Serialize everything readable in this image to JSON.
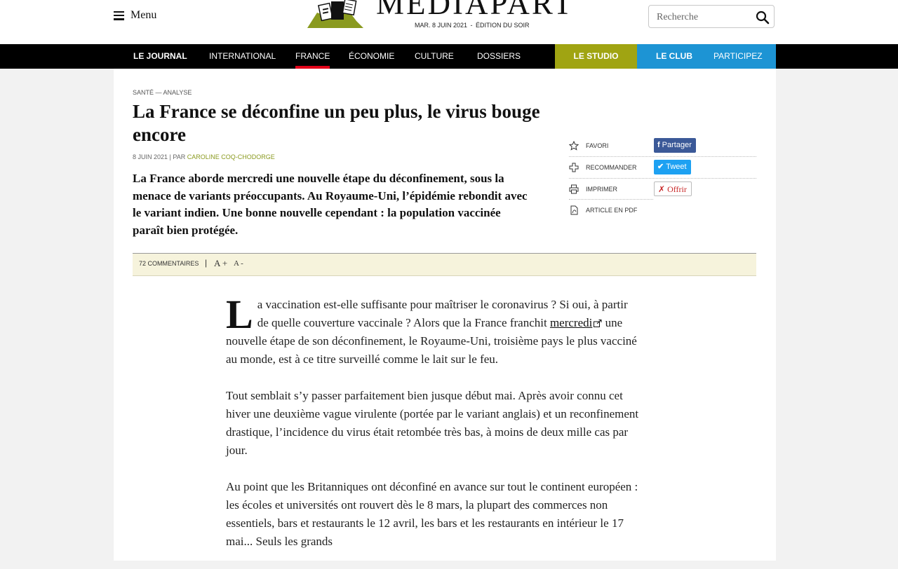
{
  "header": {
    "menu_label": "Menu",
    "logo_text": "MEDIAPART",
    "edition_date": "MAR. 8 JUIN 2021",
    "edition_label": "ÉDITION DU SOIR",
    "search_placeholder": "Recherche"
  },
  "nav": {
    "items": [
      {
        "label": "LE JOURNAL"
      },
      {
        "label": "INTERNATIONAL"
      },
      {
        "label": "FRANCE"
      },
      {
        "label": "ÉCONOMIE"
      },
      {
        "label": "CULTURE"
      },
      {
        "label": "DOSSIERS"
      }
    ],
    "active": "FRANCE",
    "studio_label": "LE STUDIO",
    "club_label": "LE CLUB",
    "participate_label": "PARTICIPEZ"
  },
  "article": {
    "kicker": "SANTÉ — ANALYSE",
    "title": "La France se déconfine un peu plus, le virus bouge encore",
    "date": "8 JUIN 2021",
    "by": "PAR",
    "author": "CAROLINE COQ-CHODORGE",
    "lede": "La France aborde mercredi une nouvelle étape du déconfinement, sous la menace de variants préoccupants. Au Royaume-Uni, l’épidémie rebondit avec le variant indien. Une bonne nouvelle cependant : la population vaccinée paraît bien protégée.",
    "dropcap": "L",
    "p1_text_a": "a vaccination est-elle suffisante pour maîtriser le coronavirus ? Si oui, à partir de quelle couverture vaccinale ? Alors que la France franchit ",
    "p1_link": "mercredi",
    "p1_text_b": " une nouvelle étape de son déconfinement, le Royaume-Uni, troisième pays le plus vacciné au monde, est à ce titre surveillé comme le lait sur le feu.",
    "p2": "Tout semblait s’y passer parfaitement bien jusque début mai. Après avoir connu cet hiver une deuxième vague virulente (portée par le variant anglais) et un reconfinement drastique, l’incidence du virus était retombée très bas, à moins de deux mille cas par jour.",
    "p3": "Au point que les Britanniques ont déconfiné en avance sur tout le continent européen : les écoles et universités ont rouvert dès le 8 mars, la plupart des commerces non essentiels, bars et restaurants le 12 avril, les bars et les restaurants en intérieur le 17 mai... Seuls les grands"
  },
  "tools": {
    "favori": "FAVORI",
    "recommander": "RECOMMANDER",
    "imprimer": "IMPRIMER",
    "pdf": "ARTICLE EN PDF",
    "share_facebook": "Partager",
    "share_twitter": "Tweet",
    "offer": "Offrir"
  },
  "toolbar": {
    "comments": "72 COMMENTAIRES",
    "separator": "|",
    "font_up": "A +",
    "font_down": "A -"
  },
  "colors": {
    "nav_bg": "#000000",
    "active_underline": "#e2001a",
    "studio_bg": "#a0a412",
    "club_bg": "#1d94d4",
    "author": "#8a9a1f",
    "facebook": "#3b5998",
    "twitter": "#1da1f2",
    "toolbar_bg": "#f6f3dc"
  },
  "icons": [
    "hamburger-icon",
    "logo-illustration",
    "search-icon",
    "star-icon",
    "plus-icon",
    "printer-icon",
    "pdf-icon",
    "facebook-icon",
    "twitter-icon",
    "gift-icon",
    "external-link-icon"
  ]
}
